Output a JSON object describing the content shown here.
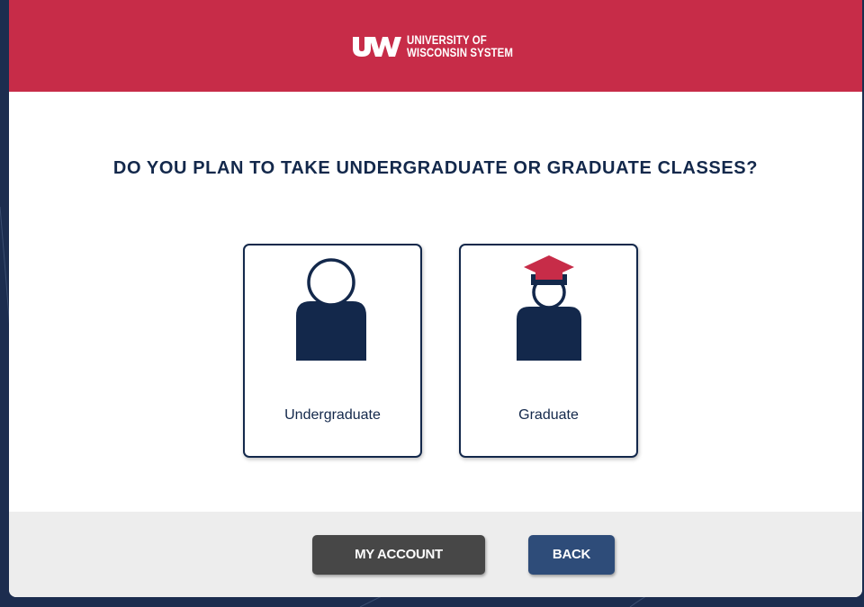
{
  "header": {
    "logo_mark": "UW",
    "logo_line1": "UNIVERSITY OF",
    "logo_line2": "WISCONSIN SYSTEM"
  },
  "question": "DO YOU PLAN TO TAKE UNDERGRADUATE OR GRADUATE CLASSES?",
  "options": [
    {
      "label": "Undergraduate",
      "icon": "person-icon"
    },
    {
      "label": "Graduate",
      "icon": "graduate-icon"
    }
  ],
  "footer": {
    "my_account_label": "MY ACCOUNT",
    "back_label": "BACK"
  },
  "colors": {
    "brand_red": "#c72c48",
    "navy": "#13284b",
    "page_background": "#1c2d4f",
    "footer_background": "#ededed",
    "my_account_button": "#474747",
    "back_button": "#2e4c79"
  }
}
